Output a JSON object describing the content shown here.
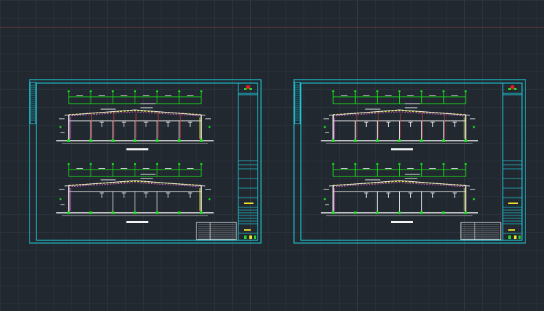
{
  "app": {
    "type": "cad-model-space",
    "background_color": "#212830",
    "grid_minor_color": "#2a323b",
    "grid_major_color": "#313a44"
  },
  "ucs_axis": {
    "x_axis_color": "#6b3a36"
  },
  "sheets": [
    {
      "name": "sheet-1",
      "border_color": "#1ec8d8",
      "sections": [
        {
          "name": "upper-frame-section"
        },
        {
          "name": "lower-frame-section"
        }
      ],
      "has_notes_table": true
    },
    {
      "name": "sheet-2",
      "border_color": "#1ec8d8",
      "sections": [
        {
          "name": "upper-frame-section"
        },
        {
          "name": "lower-frame-section"
        }
      ],
      "has_notes_table": true
    }
  ],
  "colors": {
    "frame_border": "#1ec8d8",
    "dimension_line": "#19e019",
    "column_node": "#19e019",
    "steel_member": "#f2f2f2",
    "red_axis": "#e03b3b",
    "roof_beam_top": "#e8e02a",
    "roof_beam_mid": "#f064d8",
    "title_stamp": "#f0e428",
    "logo_red": "#e02020",
    "logo_green": "#28d028",
    "notes_table": "#e8e8e8"
  }
}
